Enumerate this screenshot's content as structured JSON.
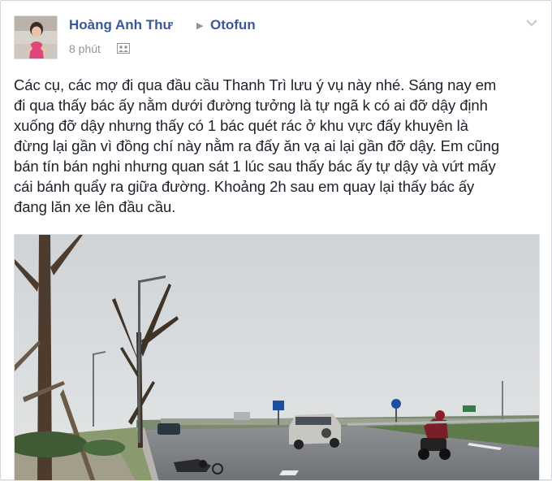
{
  "post": {
    "author": "Hoàng Anh Thư",
    "group": "Otofun",
    "time": "8 phút",
    "privacy_icon": "group-privacy-icon",
    "menu_icon": "chevron-down-icon",
    "body": "Các cụ, các mợ đi qua đầu cầu Thanh Trì lưu ý vụ này nhé. Sáng nay em\nđi qua thấy bác ấy nằm dưới đường tưởng là tự ngã k có ai đỡ dậy định\nxuống đỡ dậy nhưng thấy có 1 bác quét rác ở khu vực đấy khuyên là\nđừng lại gần vì đồng chí này nằm ra đấy ăn vạ ai lại gần đỡ dậy. Em cũng\nbán tín bán nghi nhưng quan sát 1 lúc sau thấy bác ấy tự dậy và vứt mấy\ncái bánh quẩy ra giữa đường. Khoảng 2h sau em quay lại thấy bác ấy\nđang lăn xe lên đầu cầu."
  },
  "colors": {
    "link": "#3b5998",
    "text": "#1d2129",
    "meta": "#90949c"
  }
}
